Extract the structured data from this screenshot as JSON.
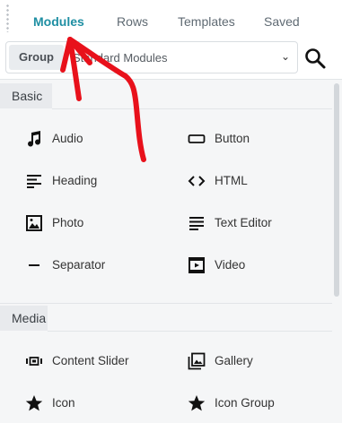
{
  "tabs": [
    {
      "label": "Modules",
      "active": true
    },
    {
      "label": "Rows",
      "active": false
    },
    {
      "label": "Templates",
      "active": false
    },
    {
      "label": "Saved",
      "active": false
    }
  ],
  "group": {
    "label": "Group",
    "value": "Standard Modules",
    "chevron_icon": "chevron-down-icon"
  },
  "search": {
    "icon": "search-icon"
  },
  "sections": [
    {
      "title": "Basic",
      "modules": [
        {
          "label": "Audio",
          "icon": "music-note-icon"
        },
        {
          "label": "Button",
          "icon": "button-icon"
        },
        {
          "label": "Heading",
          "icon": "heading-icon"
        },
        {
          "label": "HTML",
          "icon": "code-icon"
        },
        {
          "label": "Photo",
          "icon": "photo-icon"
        },
        {
          "label": "Text Editor",
          "icon": "text-editor-icon"
        },
        {
          "label": "Separator",
          "icon": "separator-icon"
        },
        {
          "label": "Video",
          "icon": "video-icon"
        }
      ]
    },
    {
      "title": "Media",
      "modules": [
        {
          "label": "Content Slider",
          "icon": "slider-icon"
        },
        {
          "label": "Gallery",
          "icon": "gallery-icon"
        },
        {
          "label": "Icon",
          "icon": "star-icon"
        },
        {
          "label": "Icon Group",
          "icon": "star-icon"
        }
      ]
    }
  ],
  "colors": {
    "accent": "#1f8fa3",
    "annotation": "#e8111b",
    "section_bg": "#e8eaed",
    "content_bg": "#f5f6f7"
  }
}
